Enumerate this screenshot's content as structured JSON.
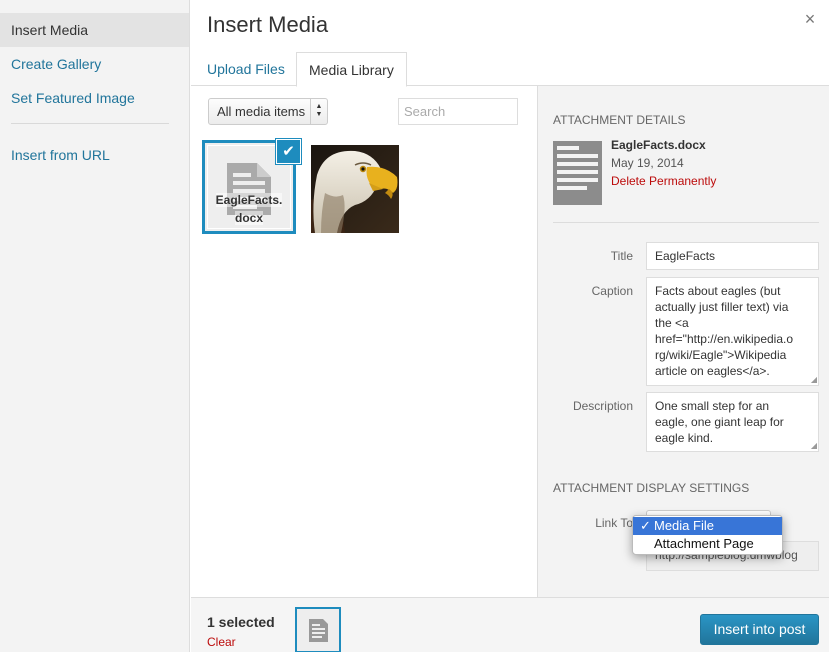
{
  "menu": {
    "items": [
      {
        "label": "Insert Media"
      },
      {
        "label": "Create Gallery"
      },
      {
        "label": "Set Featured Image"
      },
      {
        "label": "Insert from URL"
      }
    ]
  },
  "frame": {
    "title": "Insert Media",
    "close_glyph": "×",
    "tabs": [
      {
        "label": "Upload Files"
      },
      {
        "label": "Media Library"
      }
    ]
  },
  "toolbar": {
    "filter_selected": "All media items",
    "search_placeholder": "Search"
  },
  "attachments": [
    {
      "name": "EagleFacts.docx",
      "name_line1": "EagleFacts.",
      "name_line2": "docx",
      "type": "document",
      "selected": true
    },
    {
      "name": "eagle",
      "type": "image",
      "selected": false
    }
  ],
  "sidebar": {
    "details_heading": "Attachment Details",
    "filename": "EagleFacts.docx",
    "date": "May 19, 2014",
    "delete_label": "Delete Permanently",
    "title_label": "Title",
    "title_value": "EagleFacts",
    "caption_label": "Caption",
    "caption_value": "Facts about eagles (but actually just filler text) via the <a href=\"http://en.wikipedia.org/wiki/Eagle\">Wikipedia article on eagles</a>.",
    "caption_lines": [
      "Facts about eagles (but",
      "actually just filler text) via",
      "the <a",
      "href=\"http://en.wikipedia.o",
      "rg/wiki/Eagle\">Wikipedia",
      "article on eagles</a>."
    ],
    "description_label": "Description",
    "description_lines": [
      "One small step for an",
      "eagle, one giant leap for",
      "eagle kind."
    ],
    "display_heading": "Attachment Display Settings",
    "link_to_label": "Link To",
    "link_options": [
      {
        "label": "Media File",
        "selected": true
      },
      {
        "label": "Attachment Page",
        "selected": false
      }
    ],
    "url_value": "http://sampleblog.dmwblog"
  },
  "footer": {
    "selected_count": "1 selected",
    "clear_label": "Clear",
    "insert_label": "Insert into post"
  },
  "colors": {
    "accent": "#1e8cbe",
    "link": "#21759b",
    "delete": "#bc0b0b",
    "dropdown_highlight": "#3875d7"
  }
}
